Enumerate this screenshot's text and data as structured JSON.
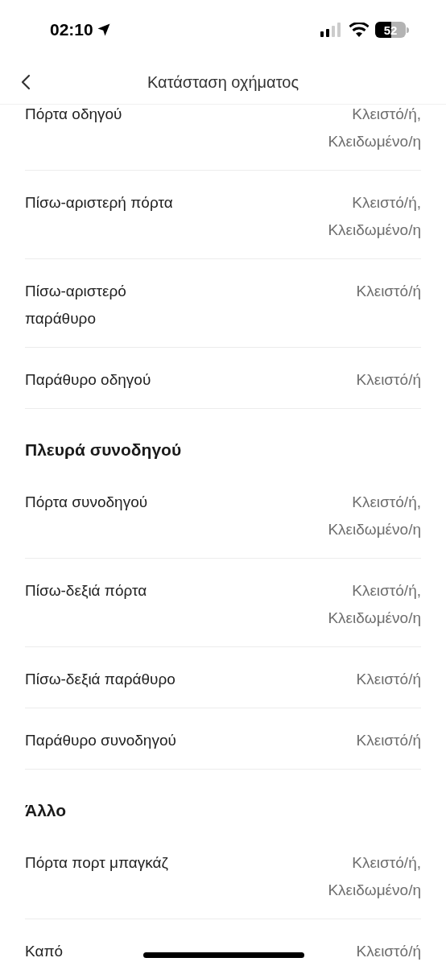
{
  "status_bar": {
    "time": "02:10",
    "battery": "52"
  },
  "header": {
    "title": "Κατάσταση οχήματος"
  },
  "sections": [
    {
      "rows": [
        {
          "label": "Πόρτα οδηγού",
          "value": "Κλειστό/ή, Κλειδωμένο/η"
        },
        {
          "label": "Πίσω-αριστερή πόρτα",
          "value": "Κλειστό/ή, Κλειδωμένο/η"
        },
        {
          "label": "Πίσω-αριστερό παράθυρο",
          "value": "Κλειστό/ή"
        },
        {
          "label": "Παράθυρο οδηγού",
          "value": "Κλειστό/ή"
        }
      ]
    },
    {
      "title": "Πλευρά συνοδηγού",
      "rows": [
        {
          "label": "Πόρτα συνοδηγού",
          "value": "Κλειστό/ή, Κλειδωμένο/η"
        },
        {
          "label": "Πίσω-δεξιά πόρτα",
          "value": "Κλειστό/ή, Κλειδωμένο/η"
        },
        {
          "label": "Πίσω-δεξιά παράθυρο",
          "value": "Κλειστό/ή"
        },
        {
          "label": "Παράθυρο συνοδηγού",
          "value": "Κλειστό/ή"
        }
      ]
    },
    {
      "title": "Άλλο",
      "rows": [
        {
          "label": "Πόρτα πορτ μπαγκάζ",
          "value": "Κλειστό/ή, Κλειδωμένο/η"
        },
        {
          "label": "Καπό",
          "value": "Κλειστό/ή"
        }
      ]
    }
  ]
}
